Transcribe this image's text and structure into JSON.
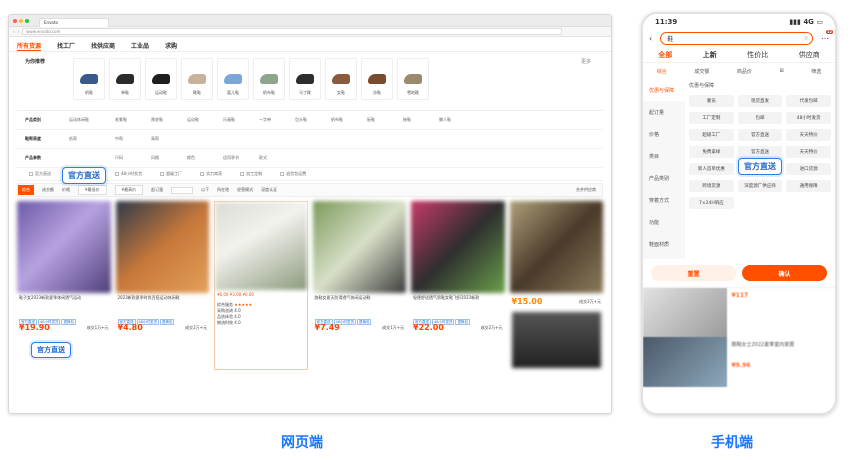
{
  "browser": {
    "tab_title": "Envato",
    "url": "www.envato.com",
    "nav": [
      "所有货源",
      "找工厂",
      "找供应商",
      "工业品",
      "求购"
    ],
    "recommend_label": "为你推荐",
    "more": "更多",
    "rec_items": [
      "帆鞋",
      "单鞋",
      "运动鞋",
      "靴鞋",
      "婴儿鞋",
      "帆布鞋",
      "马丁靴",
      "女鞋",
      "凉鞋",
      "雪地靴"
    ],
    "filters": [
      {
        "label": "产品类别",
        "options": [
          "运动休闲鞋",
          "老爹鞋",
          "厚底鞋",
          "运动鞋",
          "乐福鞋",
          "一字带",
          "包头鞋",
          "帆布鞋",
          "板鞋",
          "拖鞋",
          "懒人鞋"
        ]
      },
      {
        "label": "鞋帮高度",
        "options": [
          "低帮",
          "中帮",
          "高帮"
        ]
      },
      {
        "label": "产品参数",
        "options": [
          "尺码",
          "风格",
          "颜色",
          "适用季节",
          "款式"
        ]
      }
    ],
    "checkboxes": [
      "官方直送",
      "7×24H响应",
      "48小时发货",
      "超级工厂",
      "实力商家",
      "加工定制",
      "退货包运费"
    ],
    "sort": [
      "综合",
      "成交额",
      "价格",
      "¥最低价",
      "¥最高价",
      "起订量",
      "以下",
      "所在地",
      "经营模式",
      "深度认证",
      "合并供应商"
    ],
    "callout": "官方直送",
    "products": [
      {
        "title": "鞋子女2023新款夏季休闲透气运动",
        "tags": [
          "官方直送",
          "48小时发货",
          "退换包"
        ],
        "price": "¥19.90",
        "sold": "成交1万+元"
      },
      {
        "title": "2023新款夏季时尚百搭运动休闲鞋",
        "tags": [
          "官方直送",
          "48小时发货",
          "退换包"
        ],
        "price": "¥4.80",
        "sold": "成交2万+元"
      },
      {
        "title": "¥6.00  ¥3.00  ¥0.00",
        "tags": [
          "综合服务"
        ],
        "price": "",
        "sold": "",
        "scores": [
          "采购咨询 4.0",
          "品质体验 4.0",
          "物流时效 4.0",
          "退换体验 3.8",
          "纠纷解决 4.0"
        ]
      },
      {
        "title": "跑鞋女夏天防滑透气休闲运动鞋",
        "tags": [
          "官方直送",
          "48小时发货",
          "退换包"
        ],
        "price": "¥7.49",
        "sold": "成交1万+元"
      },
      {
        "title": "轻便舒适透气男鞋女鞋飞织2023新款",
        "tags": [
          "官方直送",
          "48小时发货",
          "退换包"
        ],
        "price": "¥22.00",
        "sold": "成交2万+元"
      },
      {
        "title": "",
        "tags": [],
        "price": "¥15.00",
        "sold": "成交2万+元"
      }
    ]
  },
  "phone": {
    "time": "11:39",
    "signal": "4G",
    "search_value": "鞋",
    "badge": "12",
    "tabs": [
      "全部",
      "上新",
      "性价比",
      "供应商"
    ],
    "sort": [
      "综合",
      "成交额",
      "商品价",
      "筛选"
    ],
    "side": [
      "优惠与保障",
      "起订量",
      "价格",
      "类目",
      "产品类别",
      "穿着方式",
      "功能",
      "鞋面材质"
    ],
    "grid_header": "优惠与保障",
    "chips": [
      "蒙员",
      "现货直发",
      "代发包邮",
      "工厂定制",
      "包邮",
      "48小时发货",
      "超级工厂",
      "官方直送",
      "天天特价",
      "免费拿样",
      "官方直送",
      "天天特价",
      "新人首单优惠",
      "品牌自营货",
      "进口货源",
      "跨境货源",
      "深度源厂供应商",
      "通用保障",
      "7×24H响应"
    ],
    "callout": "官方直送",
    "reset": "重置",
    "confirm": "确认",
    "feed_prices": [
      "¥117",
      "¥9.96"
    ],
    "feed_title": "跑鞋女士2022夏季室内家居"
  },
  "labels": {
    "web": "网页端",
    "mobile": "手机端"
  },
  "colors": {
    "accent": "#ff5000",
    "blue": "#1677ff"
  }
}
